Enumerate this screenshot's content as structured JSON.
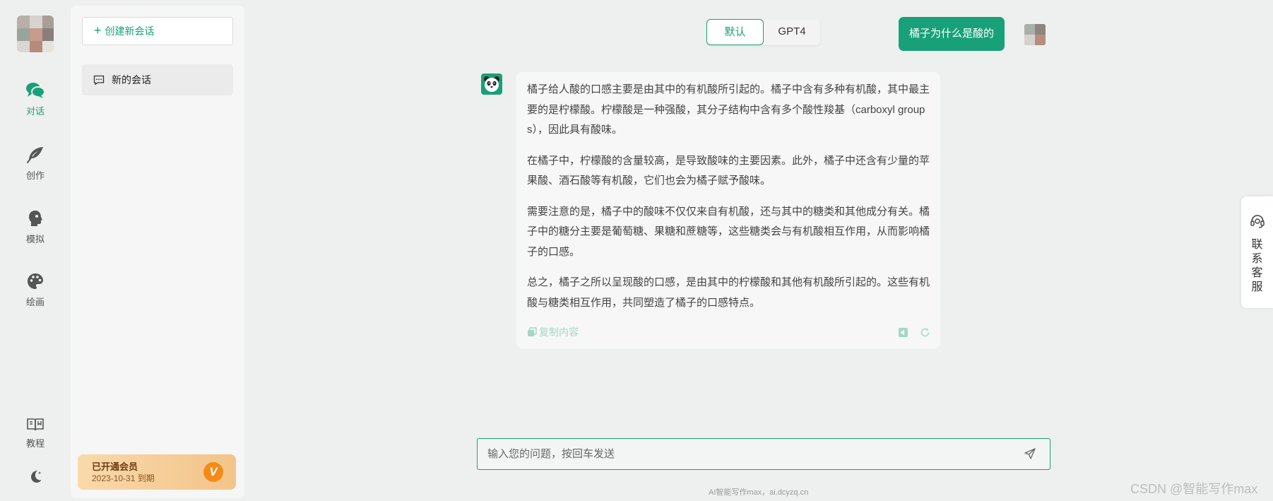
{
  "nav": {
    "items": [
      {
        "label": "对话",
        "icon": "chat-icon",
        "active": true
      },
      {
        "label": "创作",
        "icon": "feather-icon"
      },
      {
        "label": "模拟",
        "icon": "profile-head-icon"
      },
      {
        "label": "绘画",
        "icon": "palette-icon"
      },
      {
        "label": "教程",
        "icon": "book-icon"
      }
    ],
    "theme_icon": "moon-icon"
  },
  "sessions": {
    "new_chat_label": "创建新会话",
    "items": [
      {
        "label": "新的会话",
        "icon": "message-icon"
      }
    ]
  },
  "membership": {
    "status": "已开通会员",
    "expiry": "2023-10-31 到期",
    "badge": "V"
  },
  "model_toggle": {
    "options": [
      "默认",
      "GPT4"
    ],
    "selected": "默认"
  },
  "conversation": {
    "user_message": "橘子为什么是酸的",
    "assistant_paragraphs": [
      "橘子给人酸的口感主要是由其中的有机酸所引起的。橘子中含有多种有机酸，其中最主要的是柠檬酸。柠檬酸是一种强酸，其分子结构中含有多个酸性羧基（carboxyl groups），因此具有酸味。",
      "在橘子中，柠檬酸的含量较高，是导致酸味的主要因素。此外，橘子中还含有少量的苹果酸、酒石酸等有机酸，它们也会为橘子赋予酸味。",
      "需要注意的是，橘子中的酸味不仅仅来自有机酸，还与其中的糖类和其他成分有关。橘子中的糖分主要是葡萄糖、果糖和蔗糖等，这些糖类会与有机酸相互作用，从而影响橘子的口感。",
      "总之，橘子之所以呈现酸的口感，是由其中的柠檬酸和其他有机酸所引起的。这些有机酸与糖类相互作用，共同塑造了橘子的口感特点。"
    ],
    "copy_label": "复制内容"
  },
  "input": {
    "placeholder": "输入您的问题，按回车发送",
    "value": ""
  },
  "footer_note": "AI智能写作max，ai.dcyzq.cn",
  "watermark": "CSDN @智能写作max",
  "support": {
    "label": "联系客服"
  },
  "colors": {
    "accent": "#18a178",
    "member_gradient": [
      "#f9d9ab",
      "#f3c489"
    ],
    "badge": "#f48b16"
  }
}
